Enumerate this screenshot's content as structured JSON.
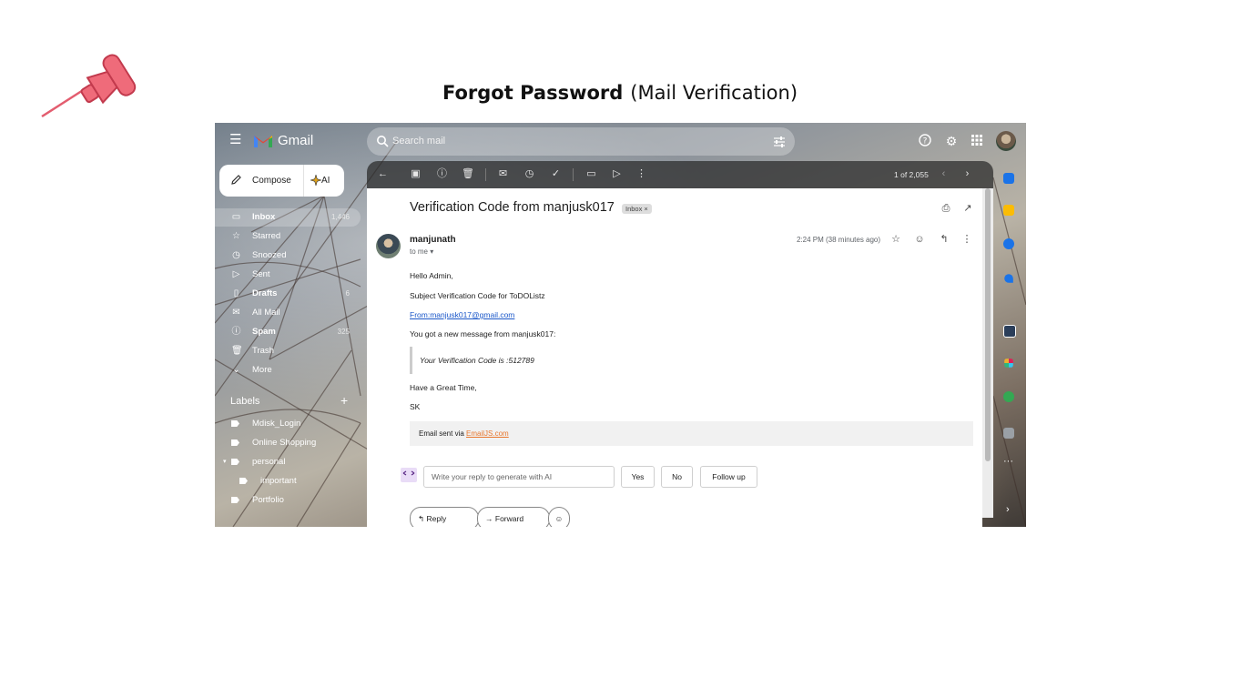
{
  "slide": {
    "title_bold": "Forgot Password",
    "title_rest": "(Mail Verification)"
  },
  "gmail": {
    "brand": "Gmail",
    "search_placeholder": "Search mail",
    "compose_label": "Compose",
    "ai_label": "AI",
    "nav": [
      {
        "label": "Inbox",
        "count": "1,446",
        "icon": "inbox-icon",
        "bold": true
      },
      {
        "label": "Starred",
        "count": "",
        "icon": "star-icon",
        "bold": false
      },
      {
        "label": "Snoozed",
        "count": "",
        "icon": "clock-icon",
        "bold": false
      },
      {
        "label": "Sent",
        "count": "",
        "icon": "send-icon",
        "bold": false
      },
      {
        "label": "Drafts",
        "count": "6",
        "icon": "draft-icon",
        "bold": true
      },
      {
        "label": "All Mail",
        "count": "",
        "icon": "all-mail-icon",
        "bold": false
      },
      {
        "label": "Spam",
        "count": "325",
        "icon": "spam-icon",
        "bold": true
      },
      {
        "label": "Trash",
        "count": "",
        "icon": "trash-icon",
        "bold": false
      },
      {
        "label": "More",
        "count": "",
        "icon": "chevron-down-icon",
        "bold": false
      }
    ],
    "labels_heading": "Labels",
    "labels": [
      {
        "label": "Mdisk_Login",
        "indent": false
      },
      {
        "label": "Online Shopping",
        "indent": false
      },
      {
        "label": "personal",
        "indent": false
      },
      {
        "label": "important",
        "indent": true
      },
      {
        "label": "Portfolio",
        "indent": false
      }
    ],
    "pager": "1 of 2,055"
  },
  "email": {
    "subject": "Verification Code from manjusk017",
    "chip": "Inbox ×",
    "sender": "manjunath",
    "to": "to me ▾",
    "time": "2:24 PM (38 minutes ago)",
    "greeting": "Hello Admin,",
    "subject_line": "Subject Verification Code for ToDOListz",
    "from_link": "From:manjusk017@gmail.com",
    "intro": "You got a new message from manjusk017:",
    "code_line": "Your Verification Code is :512789",
    "closing": "Have a Great Time,",
    "signature": "SK",
    "footer_prefix": "Email sent via ",
    "footer_link": "EmailJS.com"
  },
  "reply": {
    "placeholder": "Write your reply to generate with AI",
    "chips": [
      "Yes",
      "No",
      "Follow up"
    ],
    "reply_label": "Reply",
    "forward_label": "Forward"
  },
  "colors": {
    "pin": "#ef6b7a",
    "link": "#1a57c9",
    "footer_link": "#e8772e"
  }
}
